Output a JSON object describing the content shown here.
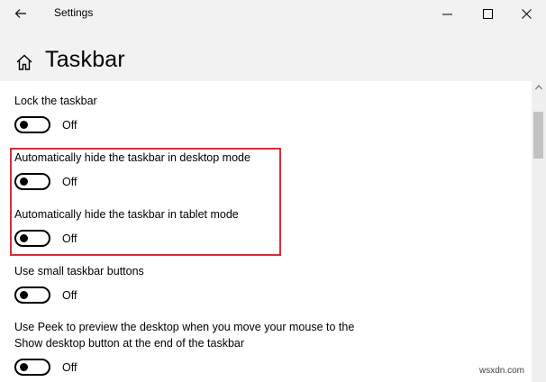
{
  "window": {
    "title": "Settings"
  },
  "page": {
    "title": "Taskbar"
  },
  "settings": [
    {
      "label": "Lock the taskbar",
      "state": "Off"
    },
    {
      "label": "Automatically hide the taskbar in desktop mode",
      "state": "Off"
    },
    {
      "label": "Automatically hide the taskbar in tablet mode",
      "state": "Off"
    },
    {
      "label": "Use small taskbar buttons",
      "state": "Off"
    },
    {
      "label_line1": "Use Peek to preview the desktop when you move your mouse to the",
      "label_line2": "Show desktop button at the end of the taskbar",
      "state": "Off"
    }
  ],
  "highlight_color": "#d62e3a",
  "watermark": "wsxdn.com",
  "icons": [
    "back-arrow-icon",
    "minimize-icon",
    "maximize-icon",
    "close-icon",
    "home-icon",
    "scroll-up-arrow-icon"
  ]
}
